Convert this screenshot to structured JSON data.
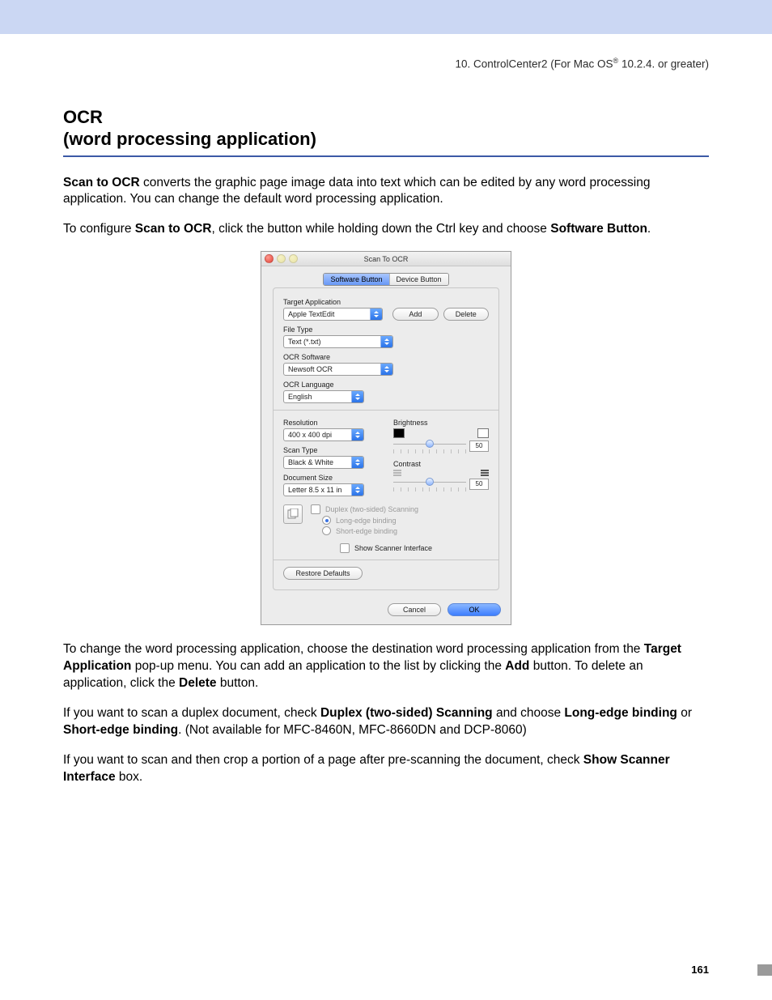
{
  "running_head": {
    "prefix": "10. ControlCenter2 (For Mac OS",
    "reg": "®",
    "suffix": " 10.2.4. or greater)"
  },
  "heading": {
    "line1": "OCR",
    "line2": "(word processing application)"
  },
  "para1": {
    "a": "Scan to OCR",
    "b": " converts the graphic page image data into text which can be edited by any word processing application. You can change the default word processing application."
  },
  "para2": {
    "a": "To configure ",
    "b": "Scan to OCR",
    "c": ", click the button while holding down the Ctrl key and choose ",
    "d": "Software Button",
    "e": "."
  },
  "dialog": {
    "title": "Scan To OCR",
    "tabs": {
      "software": "Software Button",
      "device": "Device Button"
    },
    "target_app_label": "Target Application",
    "target_app_value": "Apple TextEdit",
    "add": "Add",
    "delete": "Delete",
    "file_type_label": "File Type",
    "file_type_value": "Text (*.txt)",
    "ocr_sw_label": "OCR Software",
    "ocr_sw_value": "Newsoft OCR",
    "ocr_lang_label": "OCR Language",
    "ocr_lang_value": "English",
    "resolution_label": "Resolution",
    "resolution_value": "400 x 400 dpi",
    "scantype_label": "Scan Type",
    "scantype_value": "Black & White",
    "docsize_label": "Document Size",
    "docsize_value": "Letter  8.5 x 11 in",
    "brightness_label": "Brightness",
    "brightness_value": "50",
    "contrast_label": "Contrast",
    "contrast_value": "50",
    "duplex_label": "Duplex (two-sided) Scanning",
    "long_edge": "Long-edge binding",
    "short_edge": "Short-edge binding",
    "show_scanner": "Show Scanner Interface",
    "restore": "Restore Defaults",
    "cancel": "Cancel",
    "ok": "OK"
  },
  "para3": {
    "a": "To change the word processing application, choose the destination word processing application from the ",
    "b": "Target Application",
    "c": " pop-up menu. You can add an application to the list by clicking the ",
    "d": "Add",
    "e": " button. To delete an application, click the ",
    "f": "Delete",
    "g": " button."
  },
  "para4": {
    "a": "If you want to scan a duplex document, check ",
    "b": "Duplex (two-sided) Scanning",
    "c": " and choose ",
    "d": "Long-edge binding",
    "e": " or ",
    "f": "Short-edge binding",
    "g": ". (Not available for MFC-8460N, MFC-8660DN and DCP-8060)"
  },
  "para5": {
    "a": "If you want to scan and then crop a portion of a page after pre-scanning the document, check ",
    "b": "Show Scanner Interface",
    "c": " box."
  },
  "page_number": "161"
}
